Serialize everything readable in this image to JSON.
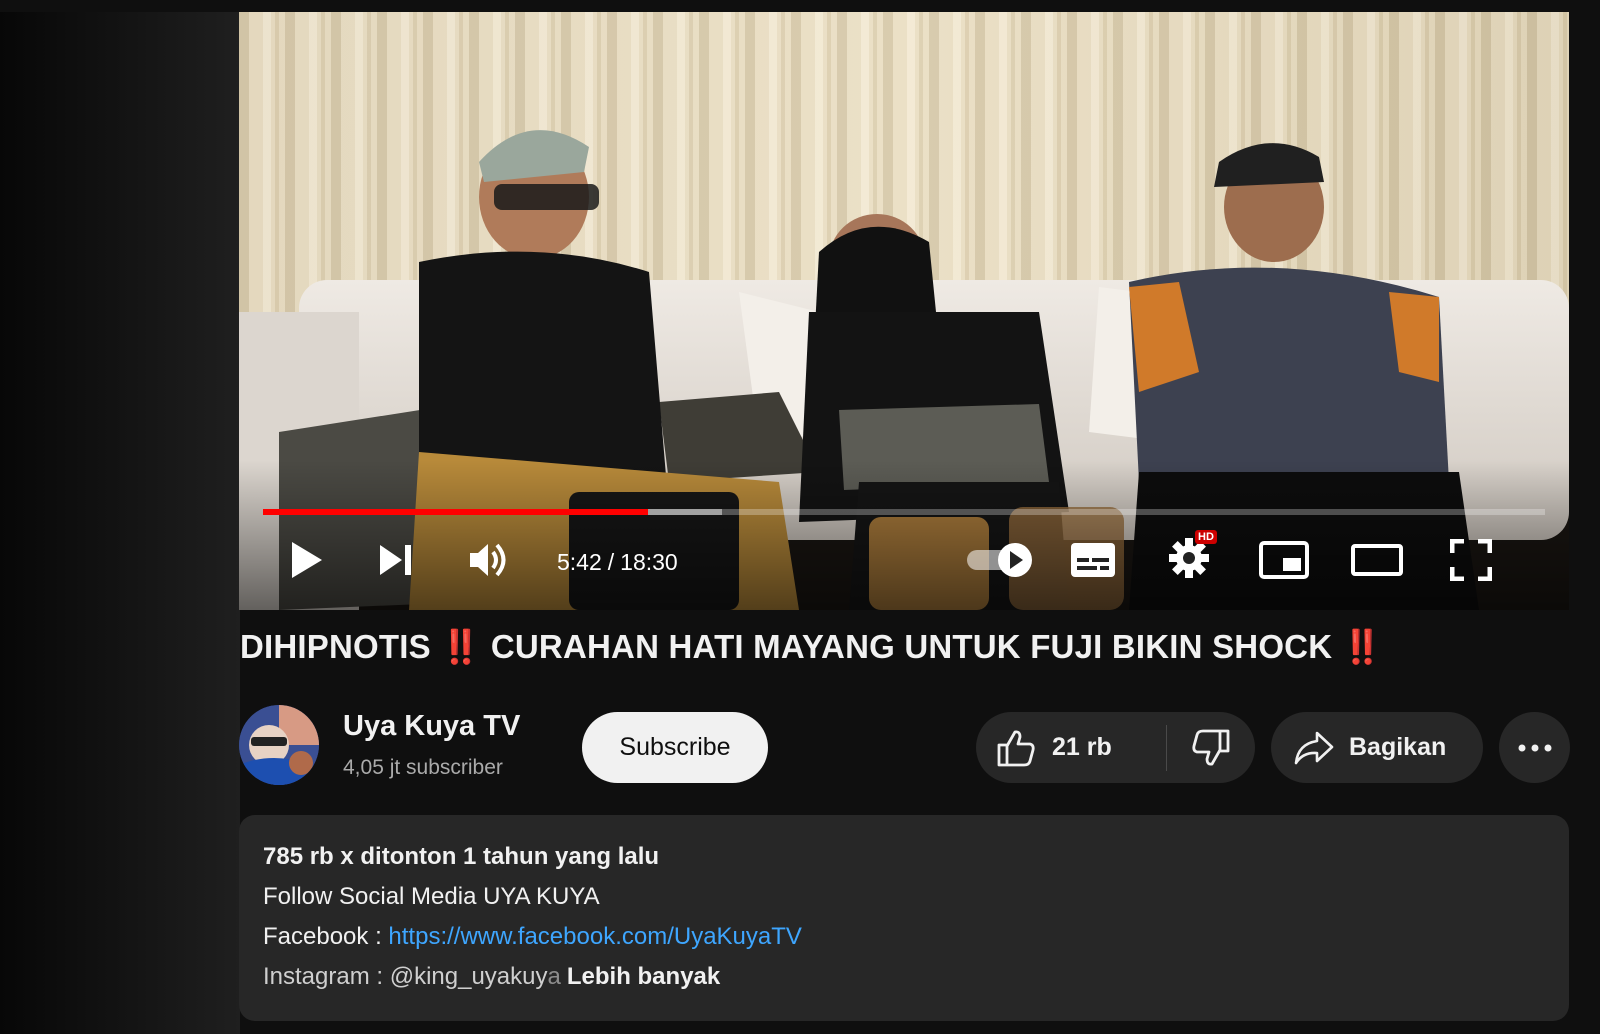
{
  "player": {
    "current_time": "5:42",
    "separator": "/",
    "duration": "18:30",
    "progress_fraction": 0.3,
    "buffered_fraction": 0.358,
    "hd_badge": "HD",
    "accent_color": "#ff0000"
  },
  "video": {
    "title": "DIHIPNOTIS ‼️ CURAHAN HATI MAYANG UNTUK FUJI BIKIN SHOCK ‼️"
  },
  "channel": {
    "name": "Uya Kuya TV",
    "subscribers": "4,05 jt subscriber",
    "subscribe_label": "Subscribe"
  },
  "actions": {
    "like_count": "21 rb",
    "share_label": "Bagikan",
    "more_icon": "more-horizontal-icon"
  },
  "description": {
    "views": "785 rb x ditonton",
    "date": "1 tahun yang lalu",
    "line1": "Follow Social Media UYA KUYA",
    "facebook_prefix": "Facebook :",
    "facebook_link": "https://www.facebook.com/UyaKuyaTV",
    "instagram_visible": "Instagram : @king_uyakuy",
    "instagram_faded": "a",
    "more_label": "Lebih banyak"
  },
  "colors": {
    "background": "#0f0f0f",
    "surface": "#272727",
    "link": "#3ea6ff",
    "secondary_text": "#aaaaaa"
  }
}
